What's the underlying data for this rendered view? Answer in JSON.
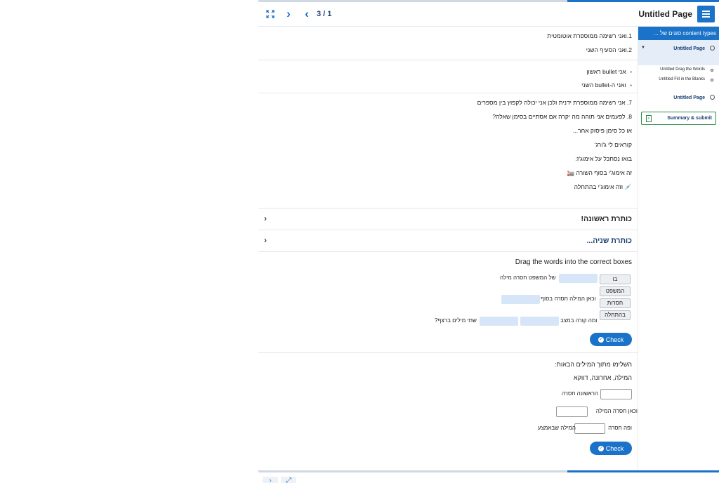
{
  "header": {
    "page_counter": "3 / 1",
    "page_title": "Untitled Page",
    "progress_fraction": 0.33
  },
  "numbered_list_1": [
    {
      "num": "1.",
      "text": "ואני רשימה ממוספרת אוטומטית"
    },
    {
      "num": "2.",
      "text": "ואני הסעיף השני"
    }
  ],
  "bullet_list": [
    "אני bullet ראשון",
    "ואני ה-bullet השני"
  ],
  "text_block": [
    "7. אני רשימה ממוספרת ידנית ולכן אני יכולה לקפוץ בין מספרים",
    "8. לפעמים אני תוהה מה יקרה אם אסתיים בסימן שאלה?",
    "או כל סימן פיסוק אחר...",
    "קוראים לי ג'ורג'",
    "בואו נסתכל על אימוג'ז:",
    "זה אימוג'י בסוף השורה 🏣",
    "💉 וזה אימוג'י בהתחלה"
  ],
  "accordions": [
    {
      "title": "כותרת ראשונה!"
    },
    {
      "title": "כותרת שניה..."
    }
  ],
  "drag_words": {
    "title": "Drag the words into the correct boxes",
    "words": [
      "בו",
      "המשפט",
      "חסרות",
      "בהתחלה"
    ],
    "sentence_1": "של המשפט חסרה מילה",
    "sentence_2": "וכאן המילה חסרה בסוף",
    "sentence_3a": "ומה קורה במצב",
    "sentence_3b": "שתי מילים ברצף?",
    "check_label": "Check"
  },
  "fill_blanks": {
    "instructions": "השלימו מתוך המילים הבאות:",
    "word_bank": "המילה, אחרונה, דווקא",
    "line_1": "הראשונה חסרה",
    "line_2": "וכאן חסרה המילה",
    "line_3a": "ופה חסרה",
    "line_3b": "המילה שבאמצע",
    "check_label": "Check"
  },
  "sidebar": {
    "header": "content types סוגים של ...",
    "items": [
      {
        "label": "Untitled Page",
        "active": true
      },
      {
        "label": "Untitled Page",
        "active": false
      }
    ],
    "sub_items": [
      "Untitled Drag the Words",
      "Untitled Fill in the Blanks"
    ],
    "summary_label": "Summary & submit"
  },
  "icons": [
    "expand-icon",
    "next-icon",
    "prev-icon",
    "menu-icon",
    "chevron-icon",
    "check-icon",
    "summary-icon"
  ],
  "colors": {
    "accent": "#1a73c8",
    "summary_border": "#2a8c4a",
    "drop_zone": "#d6e5f7"
  }
}
